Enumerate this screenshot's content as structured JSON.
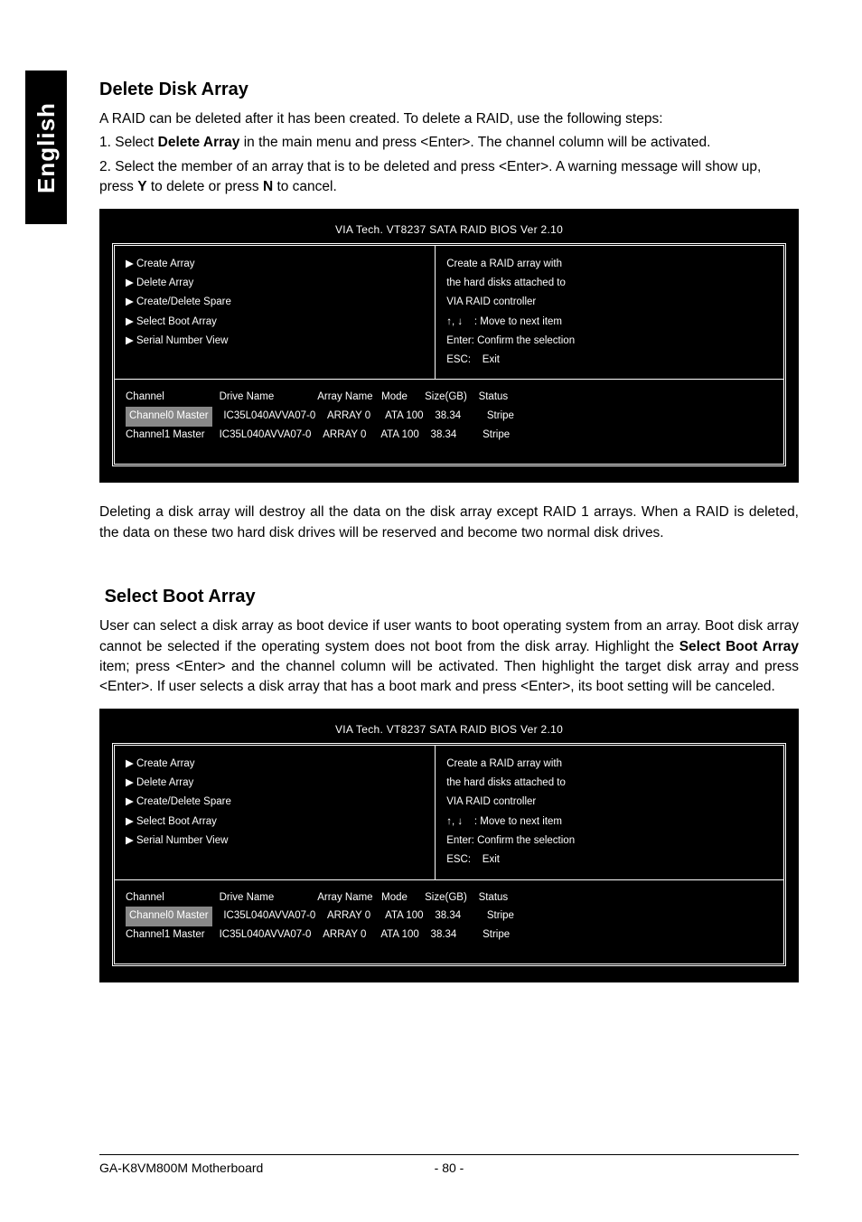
{
  "sideTab": "English",
  "section1": {
    "title": "Delete Disk Array",
    "intro": "A RAID can be deleted after it has been created.  To delete a RAID, use the following steps:",
    "step1_pre": "1. Select ",
    "step1_bold": "Delete Array",
    "step1_post": " in the main menu and press <Enter>.  The channel column will be activated.",
    "step2_pre": "2. Select the member of an array that is to be deleted and press <Enter>.  A warning message will show up, press ",
    "step2_y": "Y",
    "step2_mid": " to delete or press ",
    "step2_n": "N",
    "step2_end": " to cancel.",
    "after": "Deleting a disk array will destroy all the data on the disk array except RAID 1 arrays. When a RAID is deleted, the data on these two hard disk drives will be reserved and become two normal disk drives."
  },
  "section2": {
    "title": "Select Boot Array",
    "para_pre": "User can select a disk array  as boot device if  user wants to  boot  operating  system   from   an   array.  Boot  disk  array  cannot  be selected if the operating system does not boot from the disk array. Highlight the ",
    "para_bold": "Select Boot Array",
    "para_post": " item; press <Enter> and the channel column will be activated. Then highlight the target disk array and press <Enter>. If user selects a disk array that has a boot mark and press <Enter>, its boot setting will be canceled."
  },
  "bios": {
    "title": "VIA Tech. VT8237 SATA RAID BIOS Ver 2.10",
    "menu": [
      "Create Array",
      "Delete Array",
      "Create/Delete Spare",
      "Select Boot Array",
      "Serial Number View"
    ],
    "help1": "Create a RAID array with",
    "help2": "the hard disks attached to",
    "help3": "VIA RAID controller",
    "nav_updown": "↑, ↓",
    "nav_updown_lbl": ": Move to next item",
    "nav_enter": "Enter: Confirm the selection",
    "nav_esc": "ESC:    Exit",
    "row_channel": "Channel",
    "row_drive": "Drive Name",
    "row_array": "Array Name",
    "row_mode": "Mode",
    "row_size": "Size(GB)",
    "row_status": "Status",
    "r0_ch": "Channel0 Master",
    "r0_dn": "IC35L040AVVA07-0",
    "r0_ar": "ARRAY 0",
    "r0_mode": "ATA 100",
    "r0_size": "38.34",
    "r0_status": "Stripe",
    "r1_ch": "Channel1 Master",
    "r1_dn": "IC35L040AVVA07-0",
    "r1_ar": "ARRAY 0",
    "r1_mode": "ATA 100",
    "r1_size": "38.34",
    "r1_status": "Stripe"
  },
  "footer": {
    "left": "GA-K8VM800M Motherboard",
    "center": "- 80 -"
  }
}
